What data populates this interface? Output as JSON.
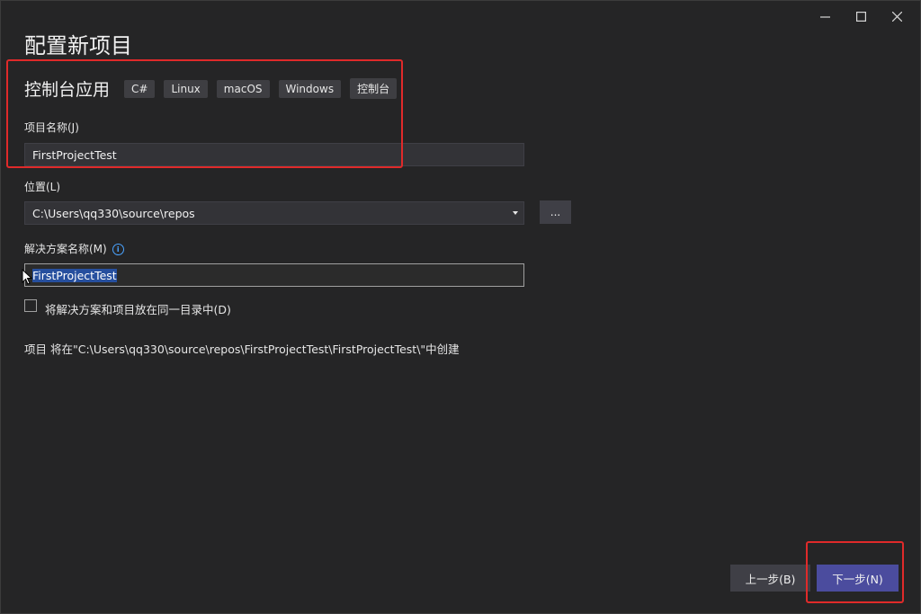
{
  "window": {
    "title": "配置新项目",
    "controls": [
      "minimize-icon",
      "maximize-icon",
      "close-icon"
    ]
  },
  "template": {
    "name": "控制台应用",
    "tags": [
      "C#",
      "Linux",
      "macOS",
      "Windows",
      "控制台"
    ]
  },
  "project_name": {
    "label": "项目名称(J)",
    "value": "FirstProjectTest"
  },
  "location": {
    "label": "位置(L)",
    "value": "C:\\Users\\qq330\\source\\repos",
    "browse_label": "..."
  },
  "solution_name": {
    "label": "解决方案名称(M)",
    "info_icon": "info-icon",
    "value": "FirstProjectTest"
  },
  "same_directory": {
    "label": "将解决方案和项目放在同一目录中(D)",
    "checked": false
  },
  "path_note": "项目 将在\"C:\\Users\\qq330\\source\\repos\\FirstProjectTest\\FirstProjectTest\\\"中创建",
  "footer": {
    "back_label": "上一步(B)",
    "next_label": "下一步(N)"
  },
  "colors": {
    "background": "#252526",
    "annotation": "#e02a2a",
    "primary_button": "#4b4c9e",
    "selection": "#264f9e"
  }
}
